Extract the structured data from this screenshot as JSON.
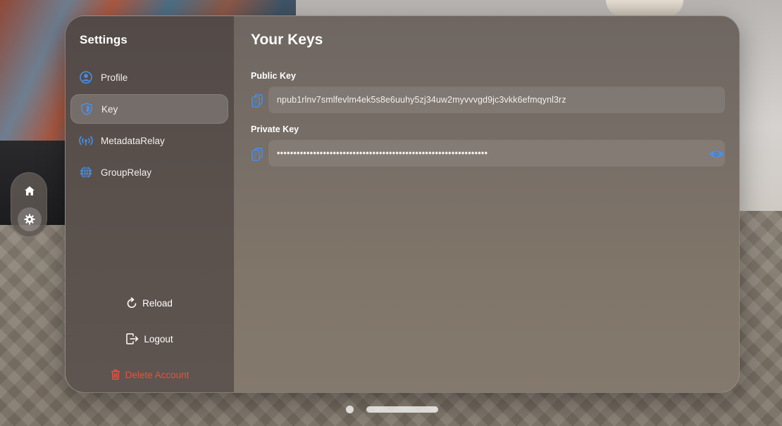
{
  "sidebar": {
    "title": "Settings",
    "items": [
      {
        "label": "Profile",
        "icon": "person-circle-icon"
      },
      {
        "label": "Key",
        "icon": "shield-icon"
      },
      {
        "label": "MetadataRelay",
        "icon": "antenna-icon"
      },
      {
        "label": "GroupRelay",
        "icon": "globe-icon"
      }
    ],
    "active_item": "Key",
    "actions": {
      "reload": "Reload",
      "logout": "Logout",
      "delete_account": "Delete Account"
    }
  },
  "main": {
    "title": "Your Keys",
    "public_key": {
      "label": "Public Key",
      "value": "npub1rlnv7smlfevlm4ek5s8e6uuhy5zj34uw2myvvvgd9jc3vkk6efmqynl3rz"
    },
    "private_key": {
      "label": "Private Key",
      "value": "••••••••••••••••••••••••••••••••••••••••••••••••••••••••••••••••"
    }
  },
  "ornament": {
    "items": [
      {
        "icon": "house-icon"
      },
      {
        "icon": "gear-icon"
      }
    ]
  },
  "colors": {
    "accent": "#4a8fe8",
    "danger": "#e5533d"
  }
}
